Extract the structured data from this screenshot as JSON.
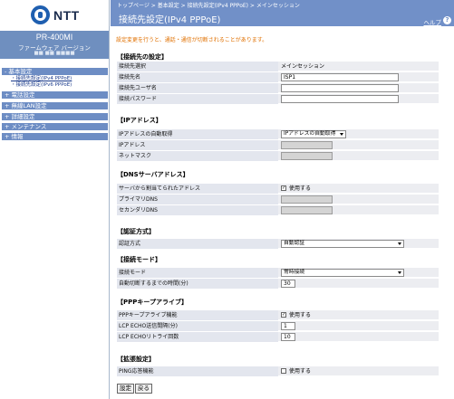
{
  "logo": {
    "text": "NTT"
  },
  "model": {
    "name": "PR-400MI",
    "fw_label": "ファームウェア バージョン",
    "fw_value": "■■ ■■ ■■■■"
  },
  "sidebar": {
    "menu": [
      {
        "label": "- 基本設定"
      },
      {
        "label": "+ 電話設定"
      },
      {
        "label": "+ 無線LAN設定"
      },
      {
        "label": "+ 詳細設定"
      },
      {
        "label": "+ メンテナンス"
      },
      {
        "label": "+ 情報"
      }
    ],
    "sub": [
      {
        "label": "・接続先設定(IPv4 PPPoE)"
      },
      {
        "label": "・接続先設定(IPv6 PPPoE)"
      }
    ]
  },
  "header": {
    "breadcrumb": "トップページ > 基本設定 > 接続先設定(IPv4 PPPoE) > メインセッション",
    "title": "接続先設定(IPv4 PPPoE)",
    "help": "ヘルプ",
    "help_icon": "?"
  },
  "notice": "設定変更を行うと、通話・通信が切断されることがあります。",
  "sections": {
    "connection": {
      "title": "【接続先の設定】",
      "rows": [
        {
          "label": "接続先選択",
          "value": "メインセッション"
        },
        {
          "label": "接続先名",
          "value": "ISP1"
        },
        {
          "label": "接続先ユーザ名",
          "value": ""
        },
        {
          "label": "接続パスワード",
          "value": ""
        }
      ]
    },
    "ip": {
      "title": "【IPアドレス】",
      "rows": [
        {
          "label": "IPアドレスの自動取得",
          "value": "IPアドレスの自動取得"
        },
        {
          "label": "IPアドレス",
          "value": ""
        },
        {
          "label": "ネットマスク",
          "value": ""
        }
      ]
    },
    "dns": {
      "title": "【DNSサーバアドレス】",
      "rows": [
        {
          "label": "サーバから割当てられたアドレス",
          "value": "使用する",
          "checked": "✓"
        },
        {
          "label": "プライマリDNS",
          "value": ""
        },
        {
          "label": "セカンダリDNS",
          "value": ""
        }
      ]
    },
    "auth": {
      "title": "【認証方式】",
      "rows": [
        {
          "label": "認証方式",
          "value": "自動認証"
        }
      ]
    },
    "mode": {
      "title": "【接続モード】",
      "rows": [
        {
          "label": "接続モード",
          "value": "常時接続"
        },
        {
          "label": "自動切断するまでの時間(分)",
          "value": "30"
        }
      ]
    },
    "keepalive": {
      "title": "【PPPキープアライブ】",
      "rows": [
        {
          "label": "PPPキープアライブ機能",
          "value": "使用する",
          "checked": "✓"
        },
        {
          "label": "LCP ECHO送信間隔(分)",
          "value": "1"
        },
        {
          "label": "LCP ECHOリトライ回数",
          "value": "10"
        }
      ]
    },
    "ext": {
      "title": "【拡張設定】",
      "rows": [
        {
          "label": "PING応答機能",
          "value": "使用する",
          "checked": ""
        }
      ]
    }
  },
  "buttons": {
    "set": "設定",
    "back": "戻る"
  }
}
